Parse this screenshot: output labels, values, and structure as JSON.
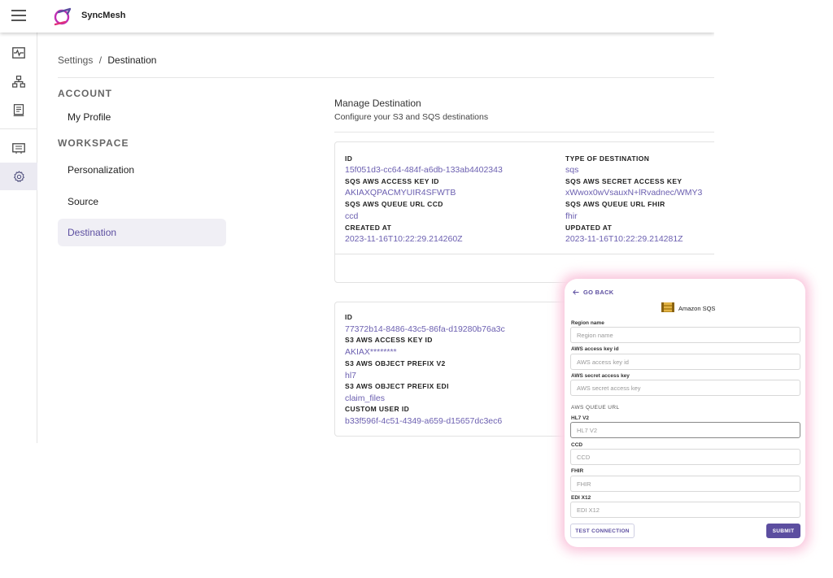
{
  "app": {
    "name": "SyncMesh",
    "accent": "#5c4ea0"
  },
  "breadcrumb": {
    "parent": "Settings",
    "separator": "/",
    "current": "Destination"
  },
  "sidebar": {
    "account_heading": "ACCOUNT",
    "workspace_heading": "WORKSPACE",
    "items": [
      {
        "label": "My Profile"
      },
      {
        "label": "Personalization"
      },
      {
        "label": "Source"
      },
      {
        "label": "Destination"
      }
    ]
  },
  "rail": {
    "icons": [
      "pulse-icon",
      "sitemap-icon",
      "document-icon",
      "message-icon",
      "gear-icon"
    ]
  },
  "main": {
    "title": "Manage Destination",
    "subtitle": "Configure your S3 and SQS destinations",
    "cards": [
      {
        "left": [
          {
            "label": "ID",
            "value": "15f051d3-cc64-484f-a6db-133ab4402343"
          },
          {
            "label": "SQS AWS ACCESS KEY ID",
            "value": "AKIAXQPACMYUIR4SFWTB"
          },
          {
            "label": "SQS AWS QUEUE URL CCD",
            "value": "ccd"
          },
          {
            "label": "CREATED AT",
            "value": "2023-11-16T10:22:29.214260Z"
          }
        ],
        "right": [
          {
            "label": "TYPE OF DESTINATION",
            "value": "sqs"
          },
          {
            "label": "SQS AWS SECRET ACCESS KEY",
            "value": "xWwox0wVsauxN+lRvadnec/WMY3"
          },
          {
            "label": "SQS AWS QUEUE URL FHIR",
            "value": "fhir"
          },
          {
            "label": "UPDATED AT",
            "value": "2023-11-16T10:22:29.214281Z"
          }
        ]
      },
      {
        "left": [
          {
            "label": "ID",
            "value": "77372b14-8486-43c5-86fa-d19280b76a3c"
          },
          {
            "label": "S3 AWS ACCESS KEY ID",
            "value": "AKIAX********"
          },
          {
            "label": "S3 AWS OBJECT PREFIX V2",
            "value": "hl7"
          },
          {
            "label": "S3 AWS OBJECT PREFIX EDI",
            "value": "claim_files"
          },
          {
            "label": "CUSTOM USER ID",
            "value": "b33f596f-4c51-4349-a659-d15657dc3ec6"
          }
        ]
      }
    ]
  },
  "modal": {
    "go_back": "GO BACK",
    "service": "Amazon SQS",
    "queue_section": "AWS QUEUE URL",
    "fields": [
      {
        "label": "Region name",
        "placeholder": "Region name"
      },
      {
        "label": "AWS access key id",
        "placeholder": "AWS access key id"
      },
      {
        "label": "AWS secret access key",
        "placeholder": "AWS secret access key"
      },
      {
        "label": "HL7 V2",
        "placeholder": "HL7 V2"
      },
      {
        "label": "CCD",
        "placeholder": "CCD"
      },
      {
        "label": "FHIR",
        "placeholder": "FHIR"
      },
      {
        "label": "EDI X12",
        "placeholder": "EDI X12"
      }
    ],
    "test_label": "TEST CONNECTION",
    "submit_label": "SUBMIT"
  }
}
